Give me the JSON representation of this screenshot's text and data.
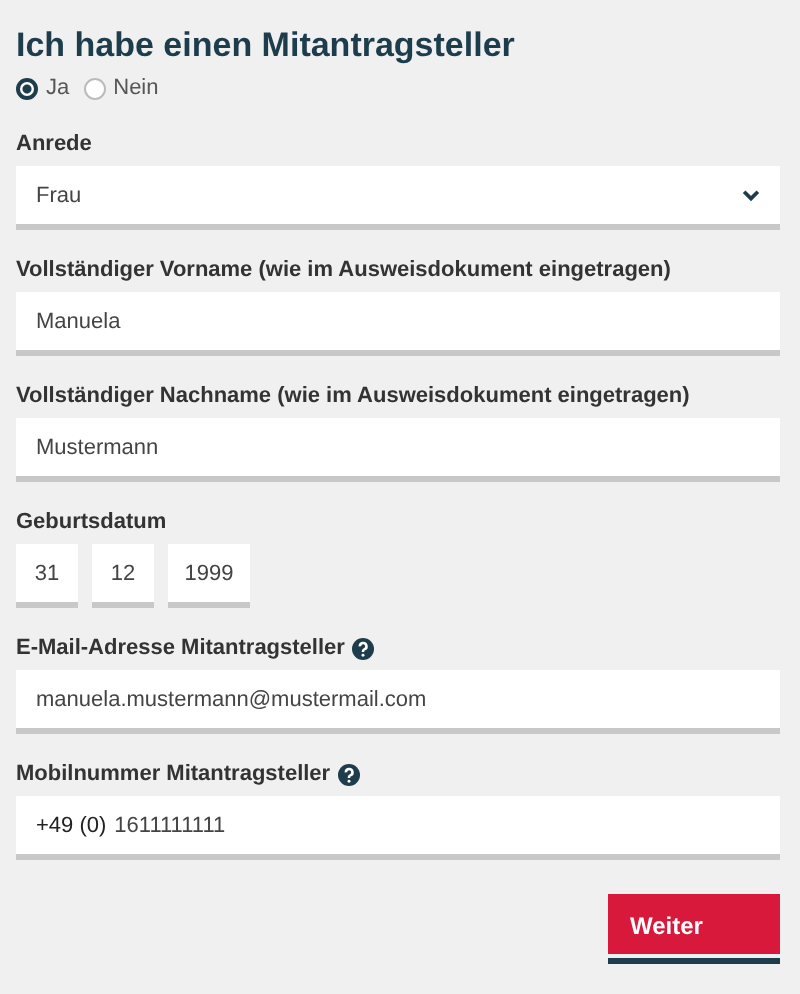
{
  "title": "Ich habe einen Mitantragsteller",
  "options": [
    {
      "label": "Ja",
      "selected": true
    },
    {
      "label": "Nein",
      "selected": false
    }
  ],
  "fields": [
    {
      "kind": "select",
      "label": "Anrede",
      "value": "Frau",
      "help": false
    },
    {
      "kind": "text",
      "label": "Vollständiger Vorname (wie im Ausweisdokument eingetragen)",
      "value": "Manuela",
      "help": false
    },
    {
      "kind": "text",
      "label": "Vollständiger Nachname (wie im Ausweisdokument eingetragen)",
      "value": "Mustermann",
      "help": false
    },
    {
      "kind": "date",
      "label": "Geburtsdatum",
      "parts": [
        "31",
        "12",
        "1999"
      ],
      "help": false
    },
    {
      "kind": "text",
      "label": "E-Mail-Adresse Mitantragsteller",
      "value": "manuela.mustermann@mustermail.com",
      "help": true
    },
    {
      "kind": "phone",
      "label": "Mobilnummer Mitantragsteller",
      "prefix": "+49 (0)",
      "value": "1611111111",
      "help": true
    }
  ],
  "button": "Weiter"
}
